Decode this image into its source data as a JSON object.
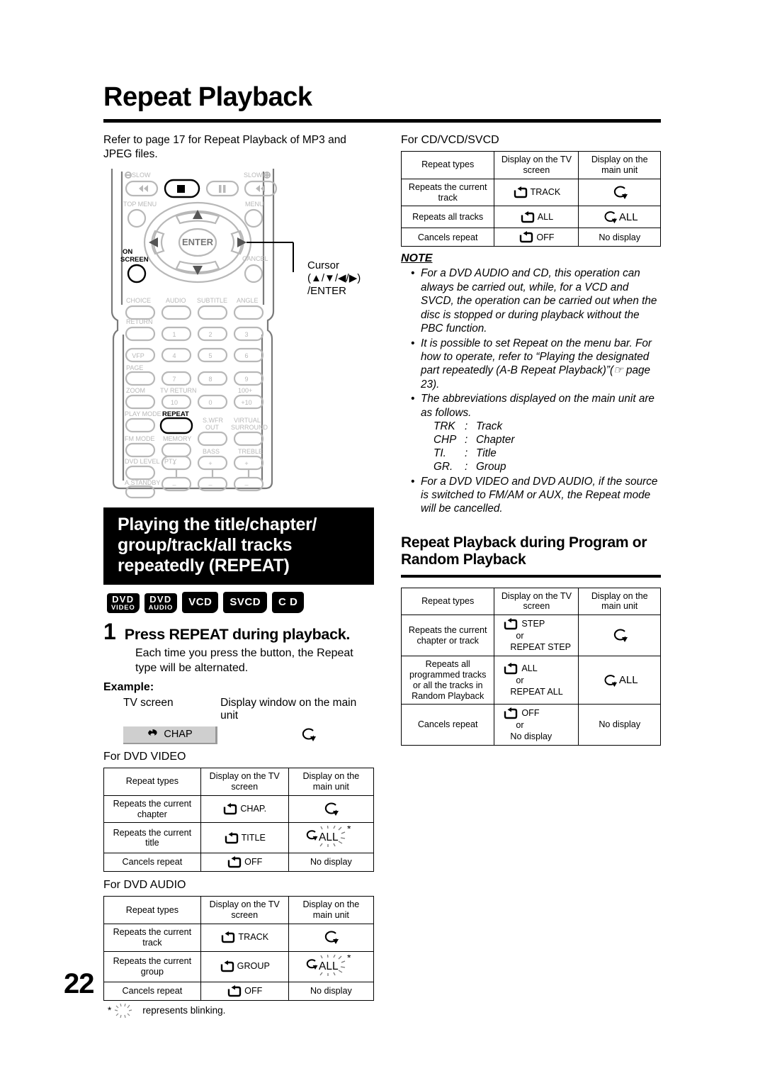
{
  "page": {
    "title": "Repeat Playback",
    "number": "22"
  },
  "intro": {
    "text": "Refer to page 17 for Repeat Playback of MP3 and JPEG files."
  },
  "remote": {
    "callout": "Cursor\n(▲/▼/◀/▶)\n/ENTER",
    "labels": {
      "slow_minus": "SLOW",
      "slow_plus": "SLOW",
      "top_menu": "TOP MENU",
      "menu": "MENU",
      "enter": "ENTER",
      "on_screen": "ON\nSCREEN",
      "cancel": "CANCEL",
      "choice": "CHOICE",
      "audio": "AUDIO",
      "subtitle": "SUBTITLE",
      "angle": "ANGLE",
      "return": "RETURN",
      "vfp": "VFP",
      "page": "PAGE",
      "zoom": "ZOOM",
      "tv_return": "TV RETURN",
      "hundred_plus": "100+",
      "play_mode": "PLAY MODE",
      "repeat": "REPEAT",
      "fm_mode": "FM MODE",
      "memory": "MEMORY",
      "swfr_out": "S.WFR\nOUT",
      "virtual_surround": "VIRTUAL\nSURROUND",
      "dvd_level": "DVD LEVEL",
      "pty": "PTY",
      "bass": "BASS",
      "treble": "TREBLE",
      "a_standby": "A.STANDBY",
      "num1": "1",
      "num2": "2",
      "num3": "3",
      "num4": "4",
      "num5": "5",
      "num6": "6",
      "num7": "7",
      "num8": "8",
      "num9": "9",
      "num10": "10",
      "num0": "0",
      "numplus10": "+10"
    }
  },
  "black_heading": "Playing the title/chapter/ group/track/all tracks repeatedly (REPEAT)",
  "badges": [
    {
      "line1": "DVD",
      "line2": "VIDEO",
      "single": false
    },
    {
      "line1": "DVD",
      "line2": "AUDIO",
      "single": false
    },
    {
      "line1": "VCD",
      "line2": "",
      "single": true
    },
    {
      "line1": "SVCD",
      "line2": "",
      "single": true
    },
    {
      "line1": "C D",
      "line2": "",
      "single": true
    }
  ],
  "step": {
    "number": "1",
    "title": "Press REPEAT during playback.",
    "body": "Each time you press the button, the Repeat type will be alternated.",
    "example_label": "Example:",
    "tv_screen_label": "TV screen",
    "main_unit_label": "Display window on the main unit",
    "chip_text": "CHAP"
  },
  "tables": {
    "headers": [
      "Repeat types",
      "Display on the TV\nscreen",
      "Display on the\nmain unit"
    ],
    "dvd_video": {
      "caption": "For DVD VIDEO",
      "rows": [
        {
          "type": "Repeats the current\nchapter",
          "tv": "CHAP.",
          "main": "loop",
          "blink": false
        },
        {
          "type": "Repeats the current\ntitle",
          "tv": "TITLE",
          "main": "ALL",
          "blink": true
        },
        {
          "type": "Cancels repeat",
          "tv": "OFF",
          "main": "No display",
          "blink": false
        }
      ]
    },
    "dvd_audio": {
      "caption": "For DVD AUDIO",
      "rows": [
        {
          "type": "Repeats the current\ntrack",
          "tv": "TRACK",
          "main": "loop",
          "blink": false
        },
        {
          "type": "Repeats the current\ngroup",
          "tv": "GROUP",
          "main": "ALL",
          "blink": true
        },
        {
          "type": "Cancels repeat",
          "tv": "OFF",
          "main": "No display",
          "blink": false
        }
      ],
      "footnote": "represents blinking.",
      "footnote_star": "*"
    },
    "cd_vcd_svcd": {
      "caption": "For CD/VCD/SVCD",
      "rows": [
        {
          "type": "Repeats the current\ntrack",
          "tv": "TRACK",
          "main": "loop",
          "blink": false
        },
        {
          "type": "Repeats all tracks",
          "tv": "ALL",
          "main": "ALL",
          "blink": false
        },
        {
          "type": "Cancels repeat",
          "tv": "OFF",
          "main": "No display",
          "blink": false
        }
      ]
    },
    "program_random": {
      "rows": [
        {
          "type": "Repeats the current\nchapter or track",
          "tv_line1": "STEP",
          "tv_or": "or",
          "tv_line2": "REPEAT STEP",
          "main": "loop"
        },
        {
          "type": "Repeats all\nprogrammed tracks\nor all the tracks in\nRandom Playback",
          "tv_line1": "ALL",
          "tv_or": "or",
          "tv_line2": "REPEAT ALL",
          "main": "ALL"
        },
        {
          "type": "Cancels repeat",
          "tv_line1": "OFF",
          "tv_or": "or",
          "tv_line2": "No display",
          "main": "No display"
        }
      ]
    }
  },
  "note": {
    "heading": "NOTE",
    "items": [
      "For a DVD AUDIO and CD, this operation can always be carried out, while, for a VCD and SVCD, the operation can be carried out when the disc is stopped or during playback without the PBC function.",
      "It is possible to set Repeat on the menu bar. For how to operate, refer to “Playing the designated part repeatedly (A-B Repeat Playback)”(☞ page 23).",
      "The abbreviations displayed on the main unit are as follows.",
      "For a DVD VIDEO and DVD AUDIO, if the source is switched to FM/AM or AUX, the Repeat mode will be cancelled."
    ],
    "abbreviations": [
      {
        "key": "TRK",
        "sep": ":",
        "val": "Track"
      },
      {
        "key": "CHP",
        "sep": ":",
        "val": "Chapter"
      },
      {
        "key": "TI.",
        "sep": ":",
        "val": "Title"
      },
      {
        "key": "GR.",
        "sep": ":",
        "val": "Group"
      }
    ]
  },
  "right_section": {
    "heading": "Repeat Playback during Program or Random Playback"
  }
}
